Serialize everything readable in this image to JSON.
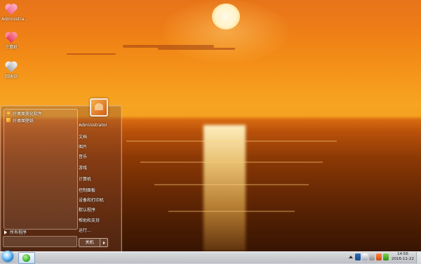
{
  "desktop": {
    "icons": [
      {
        "label": "Administra...",
        "icon": "pink-heart-icon"
      },
      {
        "label": "计算机",
        "icon": "red-heart-icon"
      },
      {
        "label": "回收站",
        "icon": "silver-heart-icon"
      }
    ]
  },
  "start_menu": {
    "pinned_programs": [
      {
        "label": "好桌面美化软件",
        "icon": "program-icon"
      },
      {
        "label": "好桌面壁纸",
        "icon": "wallpaper-icon"
      }
    ],
    "all_programs_label": "所有程序",
    "user_name": "Administrator",
    "right_items": [
      "文档",
      "图片",
      "音乐",
      "游戏",
      "计算机",
      "控制面板",
      "设备和打印机",
      "默认程序",
      "帮助和支持",
      "运行..."
    ],
    "shutdown_label": "关机"
  },
  "taskbar": {
    "clock_time": "14:56",
    "clock_date": "2016-11-22",
    "tray_icons": [
      "show-hidden-icon",
      "network-icon",
      "volume-icon",
      "flag-icon",
      "antivirus-icon",
      "security-icon"
    ]
  },
  "colors": {
    "sky_top": "#e8741a",
    "horizon": "#f7a423",
    "sea_dark": "#2f1202"
  }
}
